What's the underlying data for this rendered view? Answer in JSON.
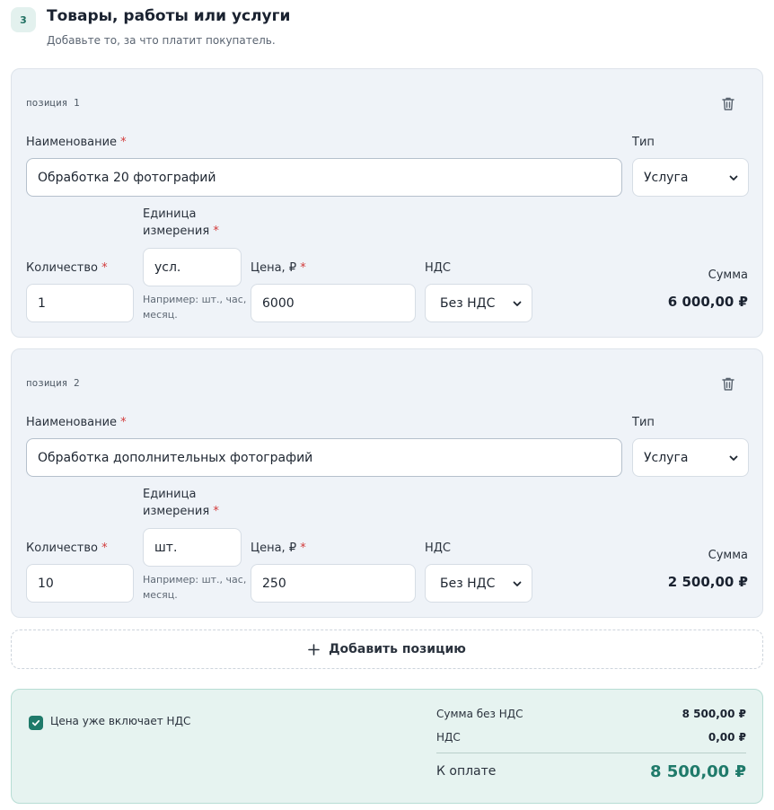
{
  "section": {
    "step": "3",
    "title": "Товары, работы или услуги",
    "subtitle": "Добавьте то, за что платит покупатель."
  },
  "labels": {
    "name": "Наименование",
    "type": "Тип",
    "unit_line1": "Единица",
    "unit_line2": "измерения",
    "quantity": "Количество",
    "price": "Цена, ₽",
    "vat": "НДС",
    "sum": "Сумма",
    "required_mark": "*",
    "unit_hint_line1": "Например: шт., час,",
    "unit_hint_line2": "месяц."
  },
  "positions": [
    {
      "label": "позиция 1",
      "name": "Обработка 20 фотографий",
      "type": "Услуга",
      "unit": "усл.",
      "quantity": "1",
      "price": "6000",
      "vat": "Без НДС",
      "sum": "6 000,00 ₽"
    },
    {
      "label": "позиция 2",
      "name": "Обработка дополнительных фотографий",
      "type": "Услуга",
      "unit": "шт.",
      "quantity": "10",
      "price": "250",
      "vat": "Без НДС",
      "sum": "2 500,00 ₽"
    }
  ],
  "add_position_label": "Добавить позицию",
  "totals": {
    "vat_included_label": "Цена уже включает НДС",
    "vat_included_checked": true,
    "sum_without_vat_label": "Сумма без НДС",
    "sum_without_vat": "8 500,00 ₽",
    "vat_label": "НДС",
    "vat": "0,00 ₽",
    "to_pay_label": "К оплате",
    "to_pay": "8 500,00 ₽"
  },
  "colors": {
    "accent": "#1f7a6a",
    "required": "#d23b3b",
    "card_bg": "#eff3f8",
    "totals_bg": "#e6f3f0"
  },
  "icons": [
    "trash-icon",
    "chevron-down-icon",
    "plus-icon",
    "check-icon"
  ]
}
